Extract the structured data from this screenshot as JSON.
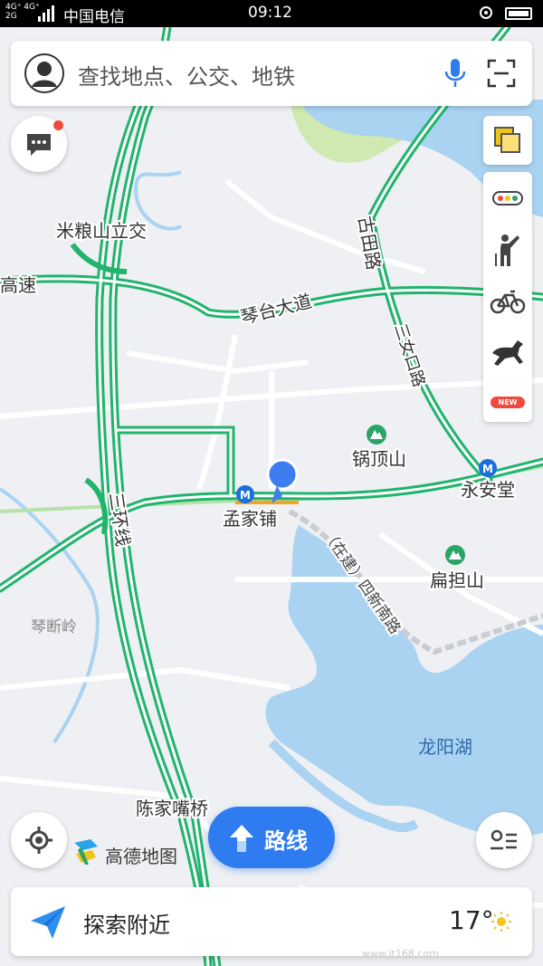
{
  "status_bar": {
    "network_top": "4G⁺ 4G⁺",
    "network_bottom": "2G",
    "carrier": "中国电信",
    "time": "09:12"
  },
  "search": {
    "placeholder": "查找地点、公交、地铁"
  },
  "map": {
    "labels": {
      "milianshan": "米粮山立交",
      "highway": "高速",
      "qintai_avenue": "琴台大道",
      "gutian_road": "古田路",
      "sanhuan_line": "三环线",
      "gudingshan": "锅顶山",
      "mengjiapu": "孟家铺",
      "yonganta": "永安堂",
      "biandanshan": "扁担山",
      "qinduanling": "琴断岭",
      "longyang_lake": "龙阳湖",
      "chenjiazuiqiao": "陈家嘴桥",
      "qingtai_road_partial": "三女口路",
      "zaijian_road": "（在建）四新南路"
    },
    "metro_glyph": "M",
    "location_marker": "current-location"
  },
  "toolbar": {
    "new_badge": "NEW",
    "items": [
      "layers-icon",
      "traffic-icon",
      "hail-taxi-icon",
      "bike-icon",
      "horse-icon"
    ]
  },
  "route_button": {
    "label": "路线"
  },
  "brand": {
    "name": "高德地图"
  },
  "bottom": {
    "nearby_label": "探索附近",
    "temperature": "17°",
    "weather_icon": "sun-icon"
  },
  "watermark": "www.it168.com",
  "colors": {
    "road_green": "#20b46c",
    "water": "#aad3f2",
    "park": "#cfe9b0",
    "accent_blue": "#2f7bf0",
    "location_blue": "#3d7df0"
  }
}
